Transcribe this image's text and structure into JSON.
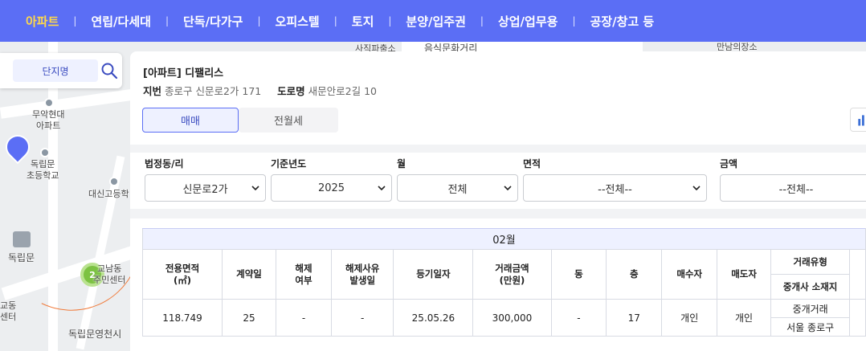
{
  "nav": {
    "items": [
      {
        "label": "아파트",
        "active": true
      },
      {
        "label": "연립/다세대",
        "active": false
      },
      {
        "label": "단독/다가구",
        "active": false
      },
      {
        "label": "오피스텔",
        "active": false
      },
      {
        "label": "토지",
        "active": false
      },
      {
        "label": "분양/입주권",
        "active": false
      },
      {
        "label": "상업/업무용",
        "active": false
      },
      {
        "label": "공장/창고 등",
        "active": false
      }
    ],
    "separator": "|",
    "colors": {
      "bar": "#5b6ef5",
      "active": "#ffd84a"
    }
  },
  "map": {
    "labels": {
      "sajik": "사직파출소",
      "culture": "음식문화거리",
      "mansion": "만남의장소",
      "muakhyundai": "무악현대\n아파트",
      "dongnimmun_school": "독립문\n초등학교",
      "daesin": "대신고등학",
      "dongnimmun": "독립문",
      "center": "교남동\n주민센터",
      "dongnim_prison": "독립문영천시",
      "left_center": "교동\n센터"
    },
    "cluster_count": "2"
  },
  "search": {
    "tab_label": "단지명",
    "icon": "search-icon"
  },
  "detail": {
    "title": "[아파트] 디팰리스",
    "jibun_label": "지번",
    "jibun_value": "종로구 신문로2가 171",
    "road_label": "도로명",
    "road_value": "새문안로2길 10",
    "tabs": [
      {
        "label": "매매",
        "active": true
      },
      {
        "label": "전월세",
        "active": false
      }
    ],
    "chart_icon": "bar-chart-icon"
  },
  "filters": {
    "dong": {
      "label": "법정동/리",
      "value": "신문로2가"
    },
    "year": {
      "label": "기준년도",
      "value": "2025"
    },
    "month": {
      "label": "월",
      "value": "전체"
    },
    "area": {
      "label": "면적",
      "value": "--전체--"
    },
    "price": {
      "label": "금액",
      "value": "--전체--"
    }
  },
  "table": {
    "month": "02월",
    "headers": {
      "area": "전용면적\n(㎡)",
      "contract_day": "계약일",
      "cancel": "해제\n여부",
      "cancel_date": "해제사유\n발생일",
      "reg_date": "등기일자",
      "price": "거래금액\n(만원)",
      "dong": "동",
      "floor": "층",
      "buyer": "매수자",
      "seller": "매도자",
      "trade_type": "거래유형",
      "agent_loc": "중개사 소재지"
    },
    "rows": [
      {
        "area": "118.749",
        "contract_day": "25",
        "cancel": "-",
        "cancel_date": "-",
        "reg_date": "25.05.26",
        "price": "300,000",
        "dong": "-",
        "floor": "17",
        "buyer": "개인",
        "seller": "개인",
        "trade_type": "중개거래",
        "agent_loc": "서울 종로구"
      }
    ]
  }
}
